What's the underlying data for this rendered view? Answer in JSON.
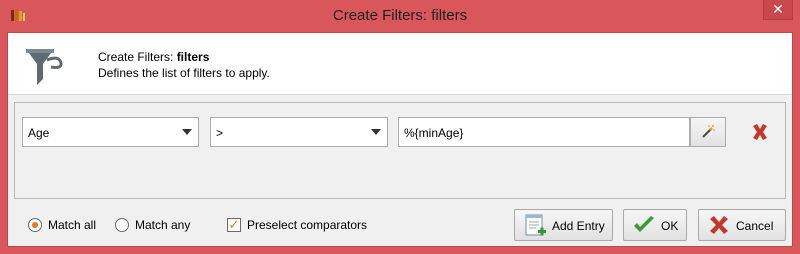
{
  "window": {
    "title": "Create Filters: filters",
    "close_label": "✕"
  },
  "header": {
    "title_prefix": "Create Filters: ",
    "title_name": "filters",
    "description": "Defines the list of filters to apply."
  },
  "filter_row": {
    "field": "Age",
    "operator": ">",
    "value": "%{minAge}"
  },
  "footer": {
    "match_all": "Match all",
    "match_any": "Match any",
    "match_selected": "all",
    "preselect_label": "Preselect comparators",
    "preselect_checked": true
  },
  "buttons": {
    "add_entry": "Add Entry",
    "ok": "OK",
    "cancel": "Cancel"
  },
  "colors": {
    "titlebar": "#d9575a",
    "accent": "#e77b18",
    "remove": "#c0392b",
    "ok_check": "#3a9b2e"
  }
}
